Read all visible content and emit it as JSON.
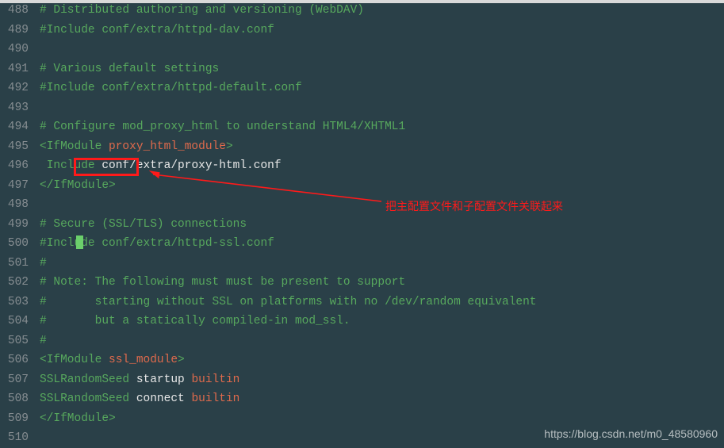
{
  "gutter": {
    "start": 488,
    "end": 510
  },
  "lines": [
    [
      {
        "t": "# Distributed authoring and versioning (WebDAV)",
        "c": "c-comment"
      }
    ],
    [
      {
        "t": "#Include conf/extra/httpd-dav.conf",
        "c": "c-comment"
      }
    ],
    [],
    [
      {
        "t": "# Various default settings",
        "c": "c-comment"
      }
    ],
    [
      {
        "t": "#Include conf/extra/httpd-default.conf",
        "c": "c-comment"
      }
    ],
    [],
    [
      {
        "t": "# Configure mod_proxy_html to understand HTML4/XHTML1",
        "c": "c-comment"
      }
    ],
    [
      {
        "t": "<IfModule ",
        "c": "c-tag"
      },
      {
        "t": "proxy_html_module",
        "c": "c-attr"
      },
      {
        "t": ">",
        "c": "c-tag"
      }
    ],
    [
      {
        "t": " Include ",
        "c": "c-tag"
      },
      {
        "t": "conf/extra/proxy-html.conf",
        "c": "c-white"
      }
    ],
    [
      {
        "t": "</IfModule>",
        "c": "c-tag"
      }
    ],
    [],
    [
      {
        "t": "# Secure (SSL/TLS) connections",
        "c": "c-comment"
      }
    ],
    [
      {
        "t": "#",
        "c": "c-comment"
      },
      {
        "t": "Include conf/extra/httpd-ssl.conf",
        "c": "c-comment"
      }
    ],
    [
      {
        "t": "#",
        "c": "c-comment"
      }
    ],
    [
      {
        "t": "# Note: The following must must be present to support",
        "c": "c-comment"
      }
    ],
    [
      {
        "t": "#       starting without SSL on platforms with no /dev/random equivalent",
        "c": "c-comment"
      }
    ],
    [
      {
        "t": "#       but a statically compiled-in mod_ssl.",
        "c": "c-comment"
      }
    ],
    [
      {
        "t": "#",
        "c": "c-comment"
      }
    ],
    [
      {
        "t": "<IfModule ",
        "c": "c-tag"
      },
      {
        "t": "ssl_module",
        "c": "c-attr"
      },
      {
        "t": ">",
        "c": "c-tag"
      }
    ],
    [
      {
        "t": "SSLRandomSeed ",
        "c": "c-tag"
      },
      {
        "t": "startup ",
        "c": "c-white"
      },
      {
        "t": "builtin",
        "c": "c-attr"
      }
    ],
    [
      {
        "t": "SSLRandomSeed ",
        "c": "c-tag"
      },
      {
        "t": "connect ",
        "c": "c-white"
      },
      {
        "t": "builtin",
        "c": "c-attr"
      }
    ],
    [
      {
        "t": "</IfModule>",
        "c": "c-tag"
      }
    ],
    []
  ],
  "annotation": "把主配置文件和子配置文件关联起来",
  "watermark": "https://blog.csdn.net/m0_48580960"
}
